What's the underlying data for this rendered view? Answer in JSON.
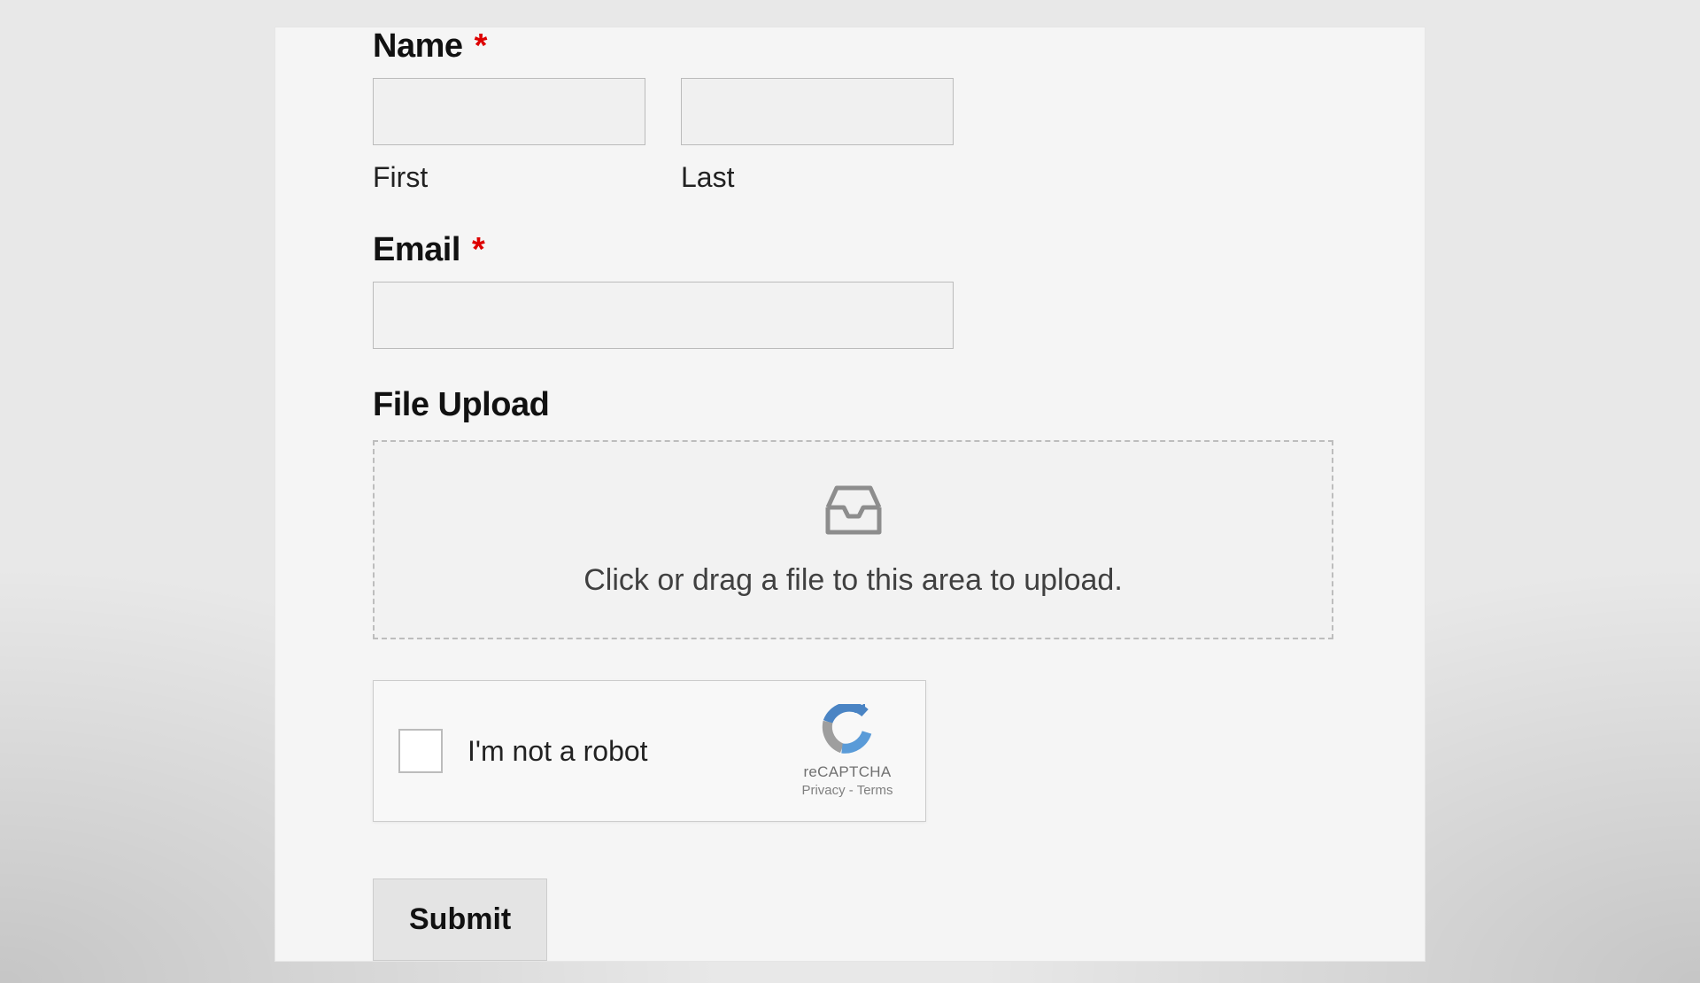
{
  "form": {
    "name": {
      "label": "Name",
      "required_mark": "*",
      "first_sub": "First",
      "last_sub": "Last",
      "first_value": "",
      "last_value": ""
    },
    "email": {
      "label": "Email",
      "required_mark": "*",
      "value": ""
    },
    "file_upload": {
      "label": "File Upload",
      "hint": "Click or drag a file to this area to upload."
    },
    "recaptcha": {
      "label": "I'm not a robot",
      "brand": "reCAPTCHA",
      "privacy": "Privacy",
      "separator": " - ",
      "terms": "Terms"
    },
    "submit_label": "Submit"
  }
}
